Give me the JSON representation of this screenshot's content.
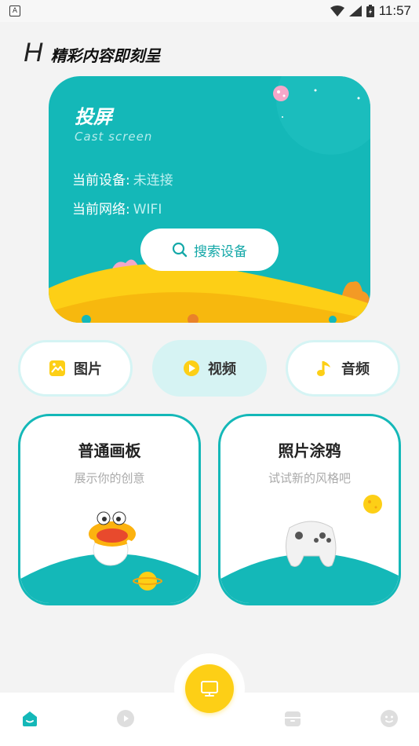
{
  "status_bar": {
    "time": "11:57",
    "left_icon": "A"
  },
  "header": {
    "logo": "H",
    "slogan": "精彩内容即刻呈"
  },
  "cast_card": {
    "title": "投屏",
    "subtitle": "Cast screen",
    "device_label": "当前设备:",
    "device_value": "未连接",
    "network_label": "当前网络:",
    "network_value": "WIFI",
    "search_button": "搜索设备"
  },
  "media_tabs": [
    {
      "label": "图片",
      "icon": "image-icon",
      "active": false
    },
    {
      "label": "视频",
      "icon": "play-icon",
      "active": true
    },
    {
      "label": "音频",
      "icon": "music-note-icon",
      "active": false
    }
  ],
  "features": [
    {
      "title": "普通画板",
      "subtitle": "展示你的创意",
      "illustration": "duck-mascot"
    },
    {
      "title": "照片涂鸦",
      "subtitle": "试试新的风格吧",
      "illustration": "gamepad"
    }
  ],
  "tab_bar": {
    "items": [
      "home-icon",
      "play-circle-icon",
      "screen-cast-icon",
      "box-icon",
      "face-icon"
    ]
  },
  "colors": {
    "teal": "#14b8b8",
    "yellow": "#fdcf16",
    "light_teal": "#d6f3f3"
  }
}
